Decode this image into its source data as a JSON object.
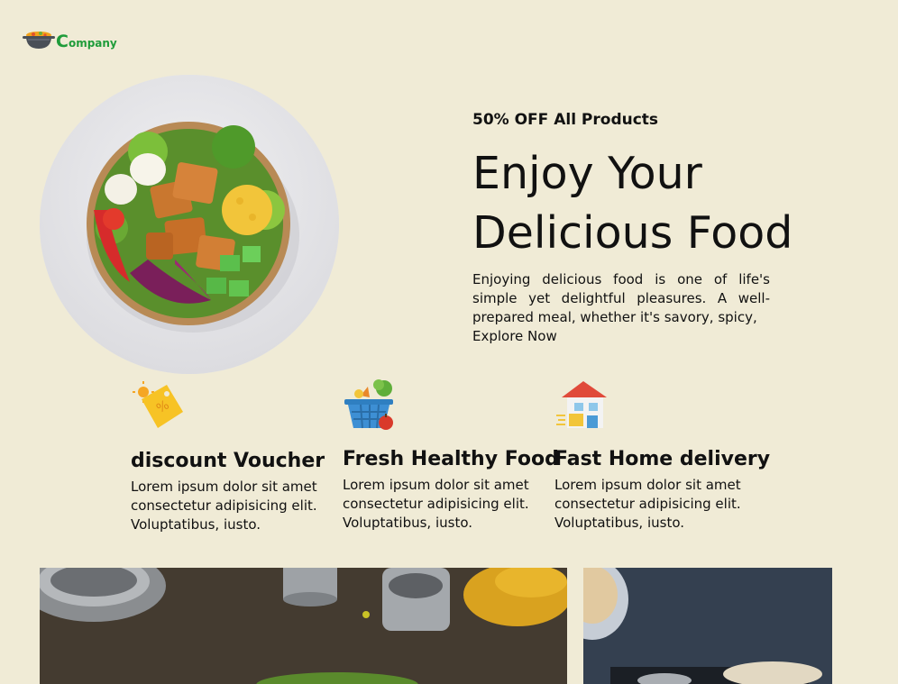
{
  "brand": {
    "logo_initial": "C",
    "logo_rest": "ompany"
  },
  "hero": {
    "promo": "50% OFF All Products",
    "title_line1": "Enjoy Your",
    "title_line2": "Delicious Food",
    "description": "Enjoying delicious food is one of life's simple yet delightful pleasures. A well-prepared meal, whether it's savory, spicy,",
    "cta": "Explore Now",
    "image_icon": "food-bowl-image"
  },
  "features": [
    {
      "icon": "discount-tag-icon",
      "title": "discount Voucher",
      "text_line1": "Lorem ipsum dolor sit amet",
      "text_line2": "consectetur adipisicing elit.",
      "text_line3": "Voluptatibus, iusto."
    },
    {
      "icon": "grocery-basket-icon",
      "title": "Fresh Healthy Food",
      "text_line1": "Lorem ipsum dolor sit amet",
      "text_line2": "consectetur adipisicing elit.",
      "text_line3": "Voluptatibus, iusto."
    },
    {
      "icon": "delivery-house-icon",
      "title": "Fast Home delivery",
      "text_line1": "Lorem ipsum dolor sit amet",
      "text_line2": "consectetur adipisicing elit.",
      "text_line3": "Voluptatibus, iusto."
    }
  ],
  "colors": {
    "background": "#f0ebd6",
    "brand_green": "#1f9c3a"
  }
}
